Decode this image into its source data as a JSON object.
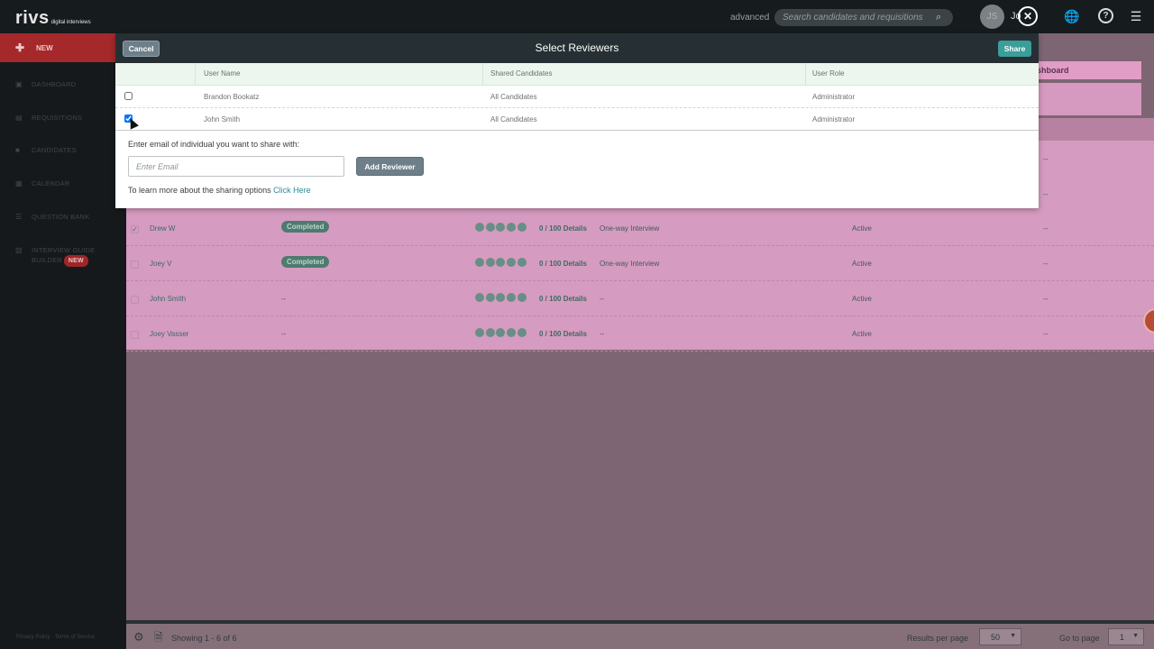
{
  "topbar": {
    "logo_text": "rivs",
    "logo_sub": "digital interviews",
    "advanced_label": "advanced",
    "search_placeholder": "Search candidates and requisitions",
    "avatar_initials": "JS",
    "username": "Jo"
  },
  "sidebar": {
    "new_label": "NEW",
    "items": [
      {
        "label": "DASHBOARD"
      },
      {
        "label": "REQUISITIONS"
      },
      {
        "label": "CANDIDATES"
      },
      {
        "label": "CALENDAR"
      },
      {
        "label": "QUESTION BANK"
      },
      {
        "label": "INTERVIEW GUIDE",
        "label2": "BUILDER",
        "badge": "NEW"
      }
    ],
    "footer": "Privacy Policy · Terms of Service"
  },
  "background": {
    "dashboard_button": "shboard",
    "dash_cells": [
      "--",
      "--"
    ],
    "rows": [
      {
        "name": "Drew W",
        "status": "Completed",
        "score": "0 / 100 Details",
        "type": "One-way Interview",
        "active": "Active",
        "end": "--",
        "checked": true
      },
      {
        "name": "Joey V",
        "status": "Completed",
        "score": "0 / 100 Details",
        "type": "One-way Interview",
        "active": "Active",
        "end": "--",
        "checked": false
      },
      {
        "name": "John Smith",
        "status": "--",
        "score": "0 / 100 Details",
        "type": "--",
        "active": "Active",
        "end": "--",
        "checked": false
      },
      {
        "name": "Joey Vasser",
        "status": "--",
        "score": "0 / 100 Details",
        "type": "--",
        "active": "Active",
        "end": "--",
        "checked": false
      }
    ]
  },
  "bottombar": {
    "showing": "Showing 1 - 6 of 6",
    "results_label": "Results per page",
    "results_value": "50",
    "goto_label": "Go to page",
    "goto_value": "1"
  },
  "modal": {
    "title": "Select Reviewers",
    "cancel_label": "Cancel",
    "share_label": "Share",
    "columns": [
      "User Name",
      "Shared Candidates",
      "User Role"
    ],
    "reviewers": [
      {
        "name": "Brandon Bookatz",
        "shared": "All Candidates",
        "role": "Administrator",
        "checked": false
      },
      {
        "name": "John Smith",
        "shared": "All Candidates",
        "role": "Administrator",
        "checked": true
      }
    ],
    "email_label": "Enter email of individual you want to share with:",
    "email_placeholder": "Enter Email",
    "add_label": "Add Reviewer",
    "learn_text": "To learn more about the sharing options",
    "learn_link": "Click Here"
  }
}
